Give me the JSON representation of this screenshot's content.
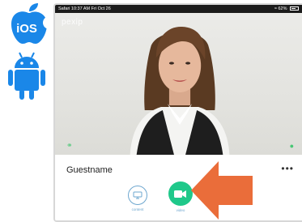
{
  "os_logos": {
    "ios_text": "iOS",
    "ios_icon": "apple-icon",
    "android_icon": "android-icon"
  },
  "status_bar": {
    "left": "Safari  10:37 AM  Fri Oct 26",
    "right": "62%"
  },
  "video": {
    "brand": "pexip"
  },
  "panel": {
    "participant_name": "Guestname",
    "more_label": "•••"
  },
  "controls": {
    "content_label": "content",
    "video_label": "video"
  },
  "colors": {
    "ios_blue": "#1a87e8",
    "android_blue": "#1a87e8",
    "video_button": "#1fc88a",
    "arrow": "#ea6d3a",
    "accent_outline": "#6ea7cf"
  }
}
